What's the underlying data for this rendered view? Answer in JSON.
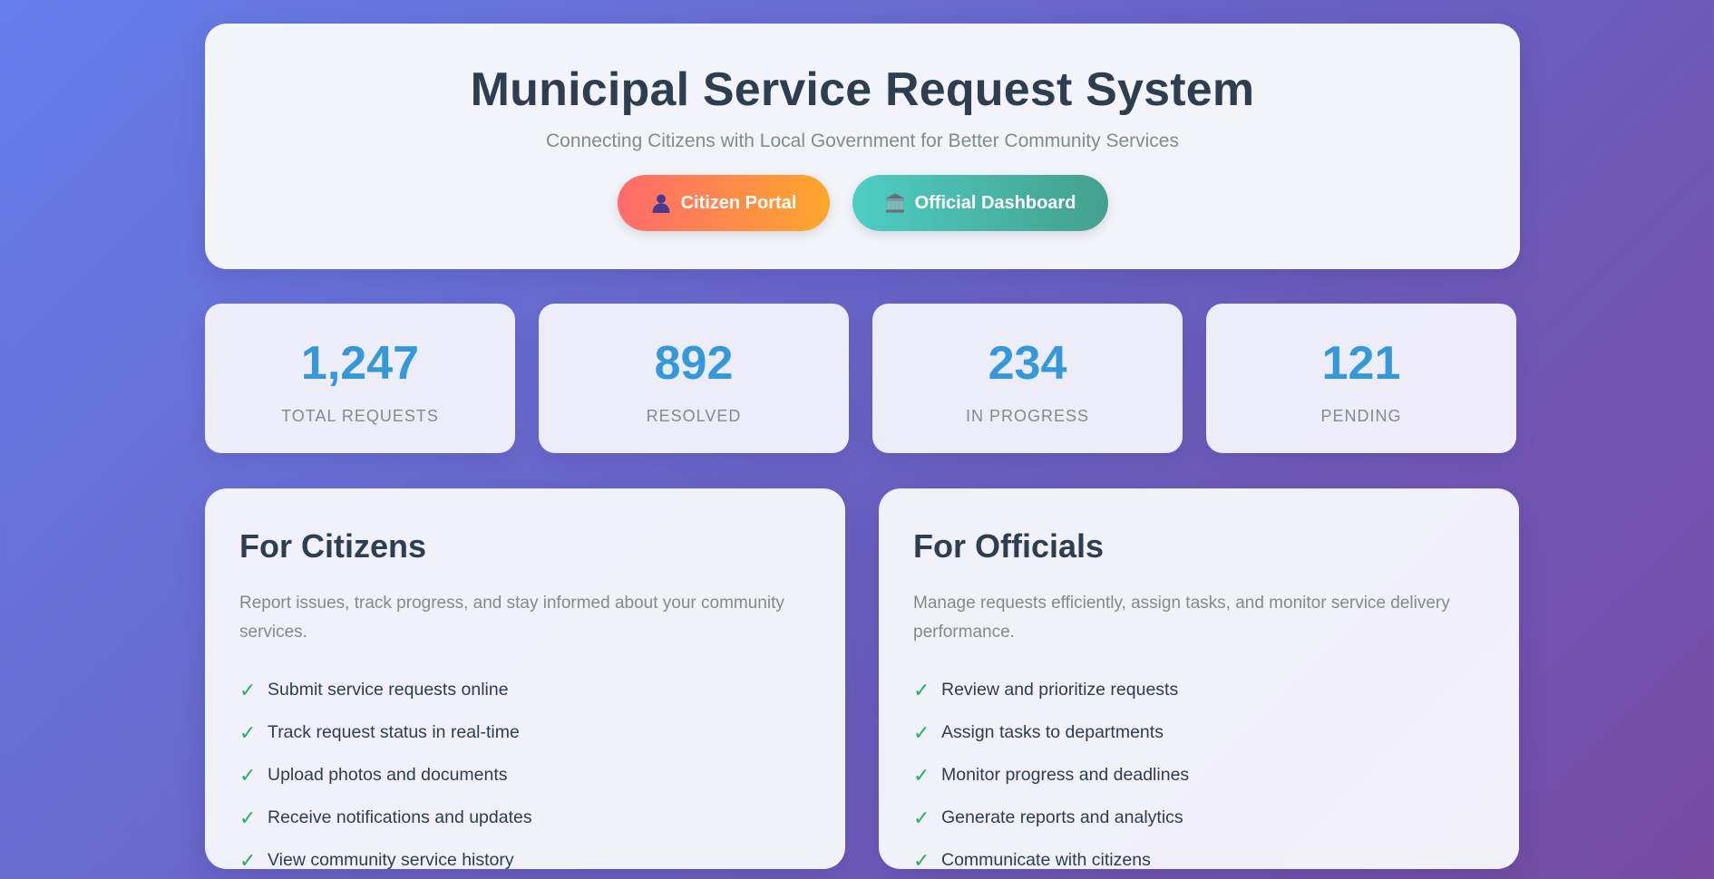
{
  "header": {
    "title": "Municipal Service Request System",
    "subtitle": "Connecting Citizens with Local Government for Better Community Services",
    "buttons": {
      "citizen_label": "Citizen Portal",
      "citizen_icon": "person-icon",
      "official_label": "Official Dashboard",
      "official_icon": "government-building-icon"
    }
  },
  "stats": [
    {
      "value": "1,247",
      "label": "Total Requests"
    },
    {
      "value": "892",
      "label": "Resolved"
    },
    {
      "value": "234",
      "label": "In Progress"
    },
    {
      "value": "121",
      "label": "Pending"
    }
  ],
  "features": {
    "citizens": {
      "title": "For Citizens",
      "description": "Report issues, track progress, and stay informed about your community services.",
      "items": [
        "Submit service requests online",
        "Track request status in real-time",
        "Upload photos and documents",
        "Receive notifications and updates",
        "View community service history"
      ]
    },
    "officials": {
      "title": "For Officials",
      "description": "Manage requests efficiently, assign tasks, and monitor service delivery performance.",
      "items": [
        "Review and prioritize requests",
        "Assign tasks to departments",
        "Monitor progress and deadlines",
        "Generate reports and analytics",
        "Communicate with citizens"
      ]
    },
    "check_glyph": "✓"
  },
  "colors": {
    "accent": "#3498db",
    "check": "#27ae60",
    "citizen_gradient_start": "#ff6b6b",
    "citizen_gradient_end": "#ffa62b",
    "official_gradient_start": "#4ecdc4",
    "official_gradient_end": "#44a08d",
    "background_start": "#667eea",
    "background_end": "#764ba2"
  }
}
